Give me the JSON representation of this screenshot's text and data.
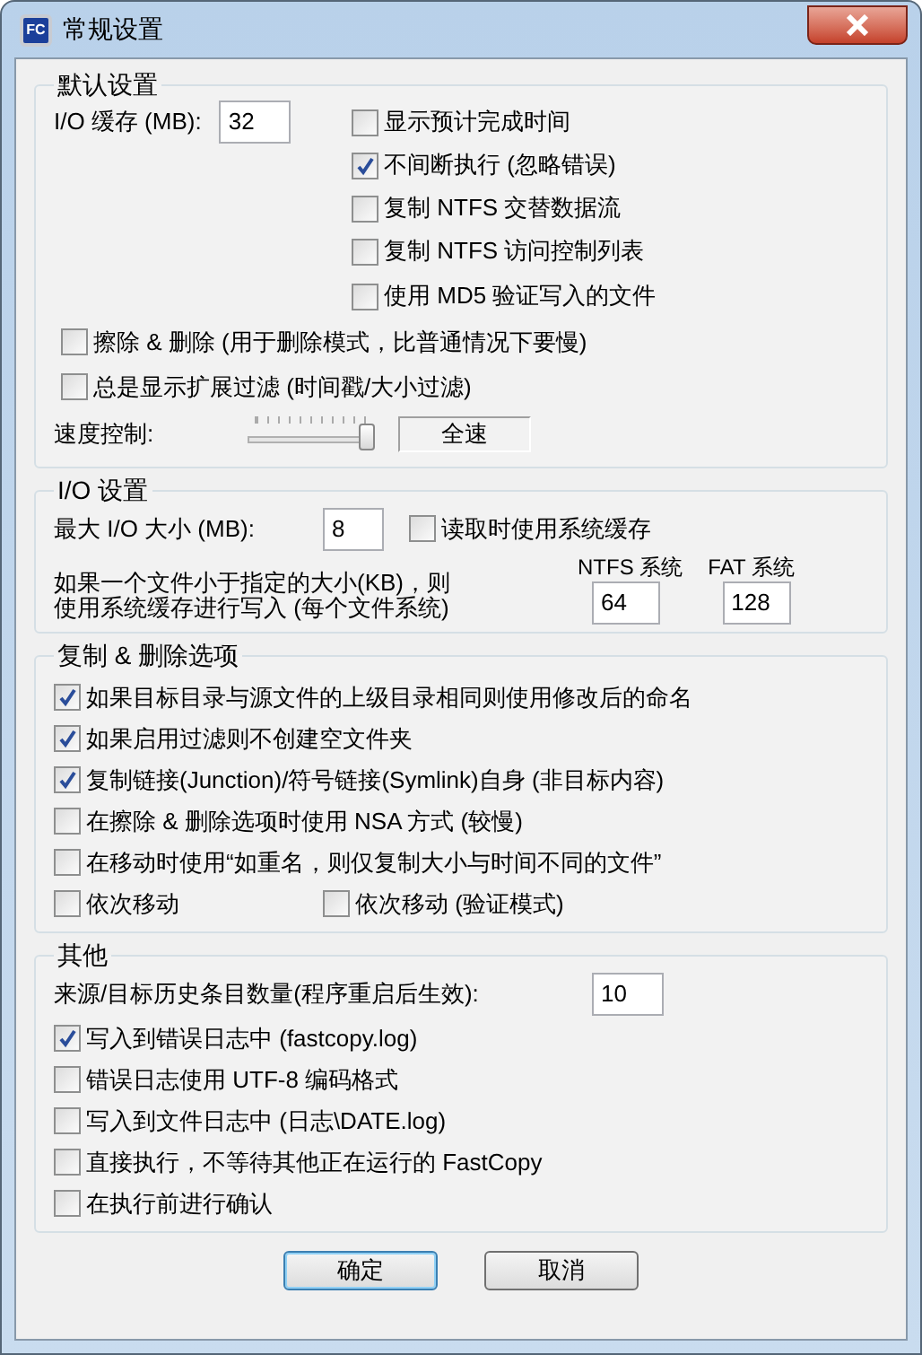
{
  "window": {
    "icon_text": "FC",
    "title": "常规设置"
  },
  "default_settings": {
    "title": "默认设置",
    "io_buffer": {
      "label": "I/O 缓存 (MB):",
      "value": "32"
    },
    "options": [
      {
        "label": "显示预计完成时间",
        "checked": false
      },
      {
        "label": "不间断执行 (忽略错误)",
        "checked": true
      },
      {
        "label": "复制 NTFS 交替数据流",
        "checked": false
      },
      {
        "label": "复制 NTFS 访问控制列表",
        "checked": false
      },
      {
        "label": "使用 MD5 验证写入的文件",
        "checked": false
      }
    ],
    "wide_options": [
      {
        "label": "擦除 & 删除 (用于删除模式，比普通情况下要慢)",
        "checked": false
      },
      {
        "label": "总是显示扩展过滤 (时间戳/大小过滤)",
        "checked": false
      }
    ],
    "speed": {
      "label": "速度控制:",
      "level": 1,
      "reading": "全速"
    }
  },
  "io_settings": {
    "title": "I/O 设置",
    "max_io": {
      "label": "最大 I/O 大小 (MB):",
      "value": "8"
    },
    "read_cache": {
      "label": "读取时使用系统缓存",
      "checked": false
    },
    "write_cache": {
      "lines": [
        "如果一个文件小于指定的大小(KB)，则",
        "使用系统缓存进行写入 (每个文件系统)"
      ],
      "fields": [
        {
          "label": "NTFS 系统",
          "value": "64"
        },
        {
          "label": "FAT 系统",
          "value": "128"
        }
      ]
    }
  },
  "copy_delete_options": {
    "title": "复制 & 删除选项",
    "options": [
      {
        "label": "如果目标目录与源文件的上级目录相同则使用修改后的命名",
        "checked": true
      },
      {
        "label": "如果启用过滤则不创建空文件夹",
        "checked": true
      },
      {
        "label": "复制链接(Junction)/符号链接(Symlink)自身 (非目标内容)",
        "checked": true
      },
      {
        "label": "在擦除 & 删除选项时使用 NSA 方式 (较慢)",
        "checked": false
      },
      {
        "label": "在移动时使用“如重名，则仅复制大小与时间不同的文件”",
        "checked": false
      }
    ],
    "move_options": [
      {
        "label": "依次移动",
        "checked": false
      },
      {
        "label": "依次移动 (验证模式)",
        "checked": false
      }
    ]
  },
  "other": {
    "title": "其他",
    "history": {
      "label": "来源/目标历史条目数量(程序重启后生效):",
      "value": "10"
    },
    "options": [
      {
        "label": "写入到错误日志中 (fastcopy.log)",
        "checked": true
      },
      {
        "label": "错误日志使用 UTF-8 编码格式",
        "checked": false
      },
      {
        "label": "写入到文件日志中 (日志\\DATE.log)",
        "checked": false
      },
      {
        "label": "直接执行，不等待其他正在运行的 FastCopy",
        "checked": false
      },
      {
        "label": "在执行前进行确认",
        "checked": false
      }
    ]
  },
  "buttons": [
    {
      "label": "确定",
      "default": true
    },
    {
      "label": "取消",
      "default": false
    }
  ]
}
